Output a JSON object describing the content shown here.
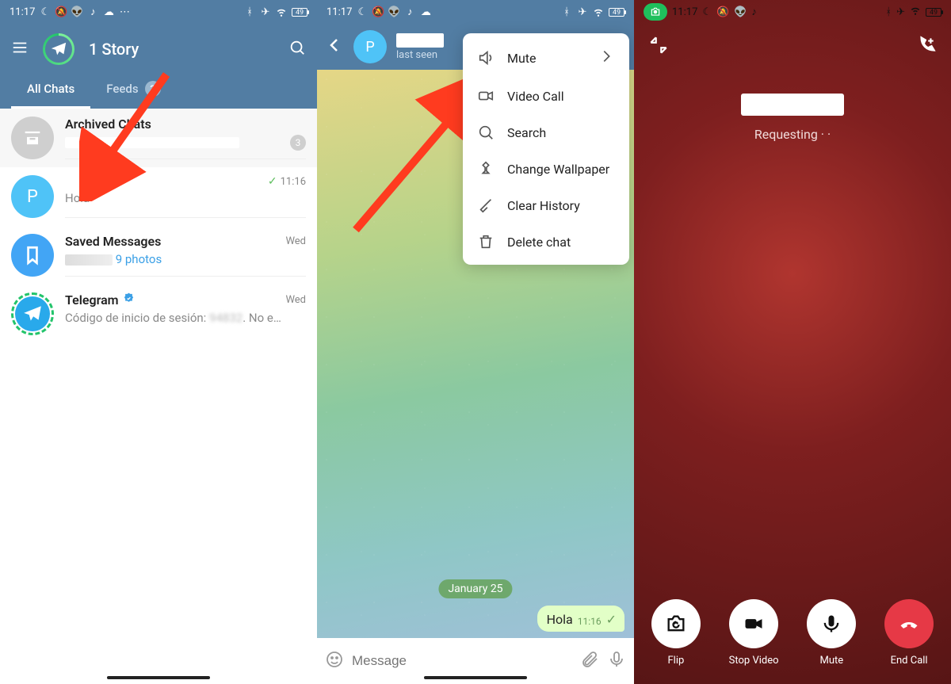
{
  "status": {
    "time": "11:17",
    "battery": "49"
  },
  "screen1": {
    "title": "1 Story",
    "tabs": {
      "all_chats": "All Chats",
      "feeds": "Feeds",
      "feeds_count": "3"
    },
    "archived": {
      "title": "Archived Chats",
      "badge": "3"
    },
    "chat_p": {
      "initial": "P",
      "msg": "Hola",
      "time": "11:16"
    },
    "saved": {
      "title": "Saved Messages",
      "sub": "9 photos",
      "time": "Wed"
    },
    "telegram": {
      "title": "Telegram",
      "sub": "Código de inicio de sesión:",
      "tail": "No e…",
      "time": "Wed"
    }
  },
  "screen2": {
    "last_seen": "last seen",
    "menu": {
      "mute": "Mute",
      "video_call": "Video Call",
      "search": "Search",
      "change_wallpaper": "Change Wallpaper",
      "clear_history": "Clear History",
      "delete_chat": "Delete chat"
    },
    "date": "January 25",
    "msg": {
      "text": "Hola",
      "time": "11:16"
    },
    "input_placeholder": "Message"
  },
  "screen3": {
    "requesting": "Requesting · ·",
    "controls": {
      "flip": "Flip",
      "stop_video": "Stop Video",
      "mute": "Mute",
      "end_call": "End Call"
    }
  }
}
